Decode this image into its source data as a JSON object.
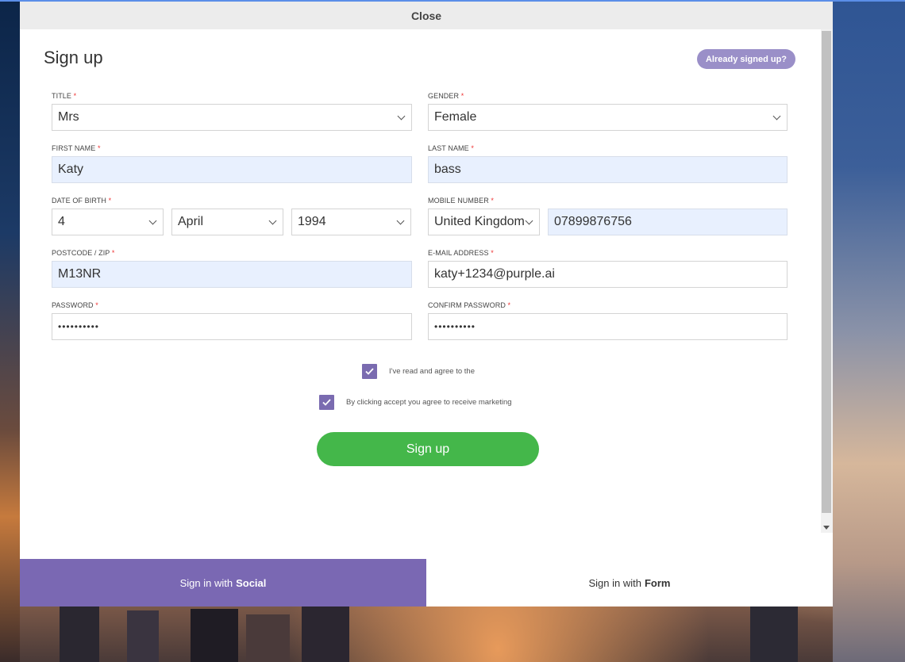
{
  "modal": {
    "close_label": "Close",
    "title": "Sign up",
    "already_signed_up": "Already signed up?"
  },
  "fields": {
    "title": {
      "label": "TITLE",
      "value": "Mrs"
    },
    "gender": {
      "label": "GENDER",
      "value": "Female"
    },
    "first_name": {
      "label": "FIRST NAME",
      "value": "Katy"
    },
    "last_name": {
      "label": "LAST NAME",
      "value": "bass"
    },
    "dob": {
      "label": "DATE OF BIRTH",
      "day": "4",
      "month": "April",
      "year": "1994"
    },
    "mobile": {
      "label": "MOBILE NUMBER",
      "country": "United Kingdom",
      "number": "07899876756"
    },
    "postcode": {
      "label": "POSTCODE / ZIP",
      "value": "M13NR"
    },
    "email": {
      "label": "E-MAIL ADDRESS",
      "value": "katy+1234@purple.ai"
    },
    "password": {
      "label": "PASSWORD",
      "value": "••••••••••"
    },
    "confirm_password": {
      "label": "CONFIRM PASSWORD",
      "value": "••••••••••"
    }
  },
  "required_mark": "*",
  "checkboxes": {
    "terms": {
      "label": "I've read and agree to the",
      "checked": true
    },
    "marketing": {
      "label": "By clicking accept you agree to receive marketing",
      "checked": true
    }
  },
  "signup_button": "Sign up",
  "tabs": {
    "social": {
      "prefix": "Sign in with",
      "bold": "Social"
    },
    "form": {
      "prefix": "Sign in with",
      "bold": "Form"
    }
  },
  "colors": {
    "accent_purple": "#7a68b3",
    "button_green": "#44b74a",
    "autofill_blue": "#e8f0fe"
  }
}
